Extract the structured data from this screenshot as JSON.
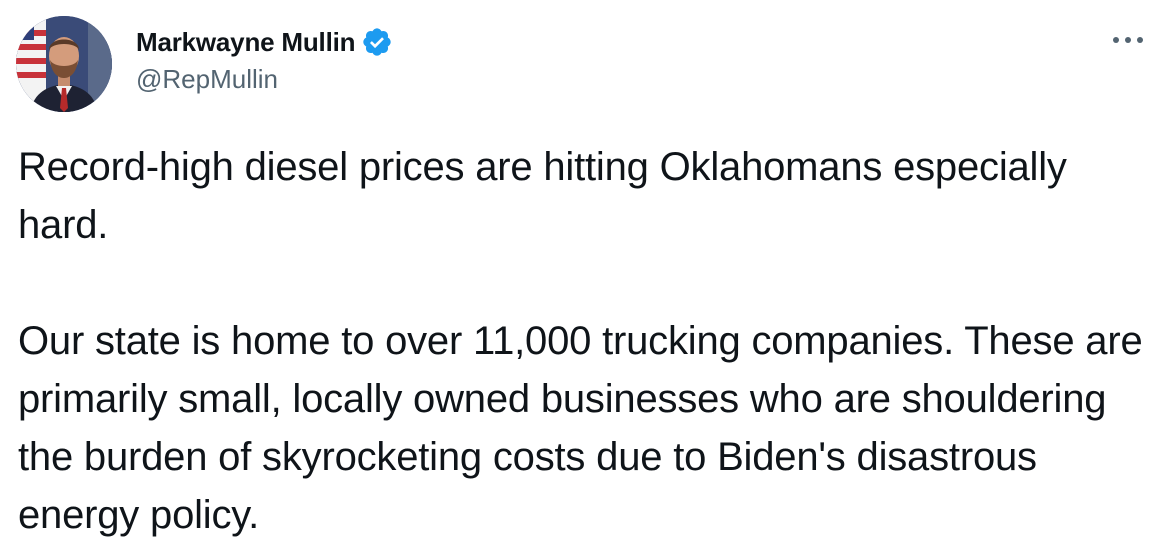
{
  "tweet": {
    "author": {
      "display_name": "Markwayne Mullin",
      "handle": "@RepMullin",
      "verified": true,
      "verified_color": "#1d9bf0"
    },
    "more_icon": "more-horizontal-icon",
    "body_paragraphs": [
      "Record-high diesel prices are hitting Oklahomans especially hard.",
      "Our state is home to over 11,000 trucking companies. These are primarily small, locally owned businesses who are shouldering the burden of skyrocketing costs due to Biden's disastrous energy policy."
    ]
  }
}
